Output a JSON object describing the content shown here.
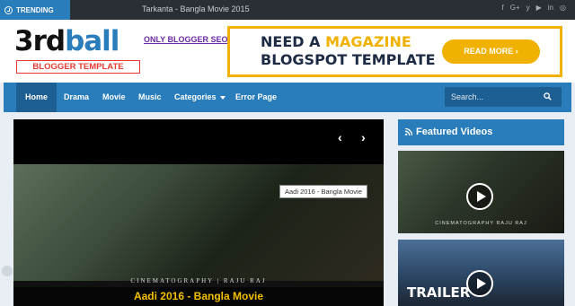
{
  "topbar": {
    "trending_label": "TRENDING",
    "trending_item": "Tarkanta - Bangla Movie 2015",
    "social_icons": [
      "facebook-icon",
      "google-plus-icon",
      "twitter-icon",
      "youtube-icon",
      "linkedin-icon",
      "instagram-icon"
    ],
    "social_glyphs": [
      "f",
      "G+",
      "y",
      "▶",
      "in",
      "◎"
    ]
  },
  "header": {
    "logo_main_a": "3rd",
    "logo_main_b": "ball",
    "logo_sub": "BLOGGER TEMPLATE",
    "link_text": "ONLY BLOGGER SEO",
    "banner_line1_a": "NEED A ",
    "banner_line1_b": "MAGAZINE",
    "banner_line2": "BLOGSPOT TEMPLATE",
    "banner_button": "READ MORE ›"
  },
  "nav": {
    "items": [
      "Home",
      "Drama",
      "Movie",
      "Music",
      "Categories",
      "Error Page"
    ],
    "search_placeholder": "Search..."
  },
  "slider": {
    "prev": "‹",
    "next": "›",
    "tooltip": "Aadi 2016 - Bangla Movie",
    "credit": "CINEMATOGRAPHY | RAJU RAJ",
    "caption": "Aadi 2016 - Bangla Movie"
  },
  "sidebar": {
    "title": "Featured Videos",
    "video1_credit": "CINEMATOGRAPHY  RAJU RAJ",
    "video2_label": "TRAILER"
  },
  "colors": {
    "primary": "#2a7dbb",
    "primary_dark": "#1e5f93",
    "accent": "#f0b100",
    "topbar": "#2a2f35"
  }
}
